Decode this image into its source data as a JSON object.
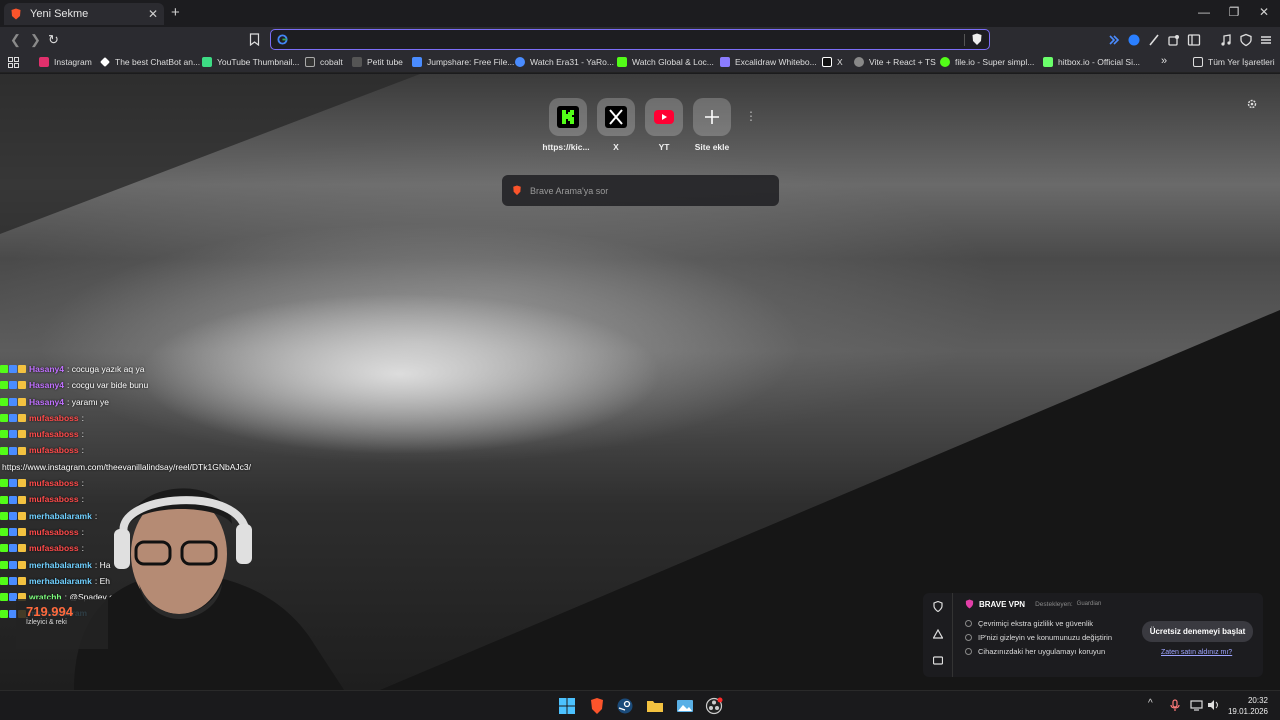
{
  "tab": {
    "title": "Yeni Sekme"
  },
  "bookmarks": [
    {
      "label": "Instagram",
      "color": "#e1306c"
    },
    {
      "label": "The best ChatBot an...",
      "color": "#ffffff"
    },
    {
      "label": "YouTube Thumbnail...",
      "color": "#3ddc84"
    },
    {
      "label": "cobalt",
      "color": "#d0d0d0"
    },
    {
      "label": "Petit tube",
      "color": "#555555"
    },
    {
      "label": "Jumpshare: Free File...",
      "color": "#4a8cff"
    },
    {
      "label": "Watch Era31 - YaRo...",
      "color": "#4a8cff"
    },
    {
      "label": "Watch Global & Loc...",
      "color": "#53fc18"
    },
    {
      "label": "Excalidraw Whitebo...",
      "color": "#8b7cff"
    },
    {
      "label": "X",
      "color": "#ffffff"
    },
    {
      "label": "Vite + React + TS",
      "color": "#bbbbbb"
    },
    {
      "label": "file.io - Super simpl...",
      "color": "#53fc18"
    },
    {
      "label": "hitbox.io - Official Si...",
      "color": "#6bff6b"
    }
  ],
  "all_bookmarks": "Tüm Yer İşaretleri",
  "tiles": [
    {
      "label": "https://kic...",
      "icon": "kick-icon"
    },
    {
      "label": "X",
      "icon": "x-icon"
    },
    {
      "label": "YT",
      "icon": "youtube-icon"
    },
    {
      "label": "Site ekle",
      "icon": "plus-icon"
    }
  ],
  "search": {
    "placeholder": "Brave Arama'ya sor"
  },
  "chat": [
    {
      "user": "Hasany4",
      "msg": ": cocuga yazık aq ya",
      "color": "#c070ff"
    },
    {
      "user": "Hasany4",
      "msg": ": cocgu var bide bunu",
      "color": "#c070ff"
    },
    {
      "user": "Hasany4",
      "msg": ": yaramı ye",
      "color": "#c070ff"
    },
    {
      "user": "mufasaboss",
      "msg": ":",
      "color": "#ff4a4a"
    },
    {
      "user": "mufasaboss",
      "msg": ":",
      "color": "#ff4a4a"
    },
    {
      "user": "mufasaboss",
      "msg": ":",
      "color": "#ff4a4a"
    },
    {
      "user": "",
      "msg": "https://www.instagram.com/theevanillalindsay/reel/DTk1GNbAJc3/",
      "color": "#ffffff"
    },
    {
      "user": "mufasaboss",
      "msg": ":",
      "color": "#ff4a4a"
    },
    {
      "user": "mufasaboss",
      "msg": ":",
      "color": "#ff4a4a"
    },
    {
      "user": "merhabalaramk",
      "msg": ":",
      "color": "#6fd0ff"
    },
    {
      "user": "mufasaboss",
      "msg": ":",
      "color": "#ff4a4a"
    },
    {
      "user": "mufasaboss",
      "msg": ":",
      "color": "#ff4a4a"
    },
    {
      "user": "merhabalaramk",
      "msg": ": Ha",
      "color": "#6fd0ff"
    },
    {
      "user": "merhabalaramk",
      "msg": ": Eh",
      "color": "#6fd0ff"
    },
    {
      "user": "wratchh",
      "msg": ": @Spadev e",
      "color": "#7dff7d"
    },
    {
      "user": "merhabalaram",
      "msg": "",
      "color": "#6fd0ff"
    }
  ],
  "viewers": {
    "count": "719.994",
    "label": "İzleyici & reki"
  },
  "vpn": {
    "title": "BRAVE VPN",
    "supported": "Destekleyen:",
    "partner": "Guardian",
    "items": [
      "Çevrimiçi ekstra gizlilik ve güvenlik",
      "IP'nizi gizleyin ve konumunuzu değiştirin",
      "Cihazınızdaki her uygulamayı koruyun"
    ],
    "cta": "Ücretsiz denemeyi başlat",
    "link": "Zaten satın aldınız mı?"
  },
  "clock": {
    "time": "20:32",
    "date": "19.01.2026"
  }
}
